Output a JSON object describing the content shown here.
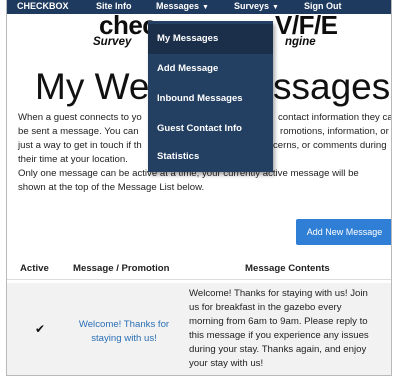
{
  "nav": {
    "brand": "CHECKBOX",
    "site_info": "Site Info",
    "messages": "Messages",
    "surveys": "Surveys",
    "sign_out": "Sign Out",
    "caret": "▼"
  },
  "dropdown": {
    "items": [
      "My Messages",
      "Add Message",
      "Inbound Messages",
      "Guest Contact Info",
      "Statistics"
    ]
  },
  "logo": {
    "left_main": "chec",
    "right_main": "V/F/E",
    "left_sub": "Survey",
    "right_sub": "ngine"
  },
  "page": {
    "title_left": "My Wel",
    "title_right": "ssages",
    "intro_lines": [
      {
        "left": "When a guest connects to yo",
        "right": "contact information they can"
      },
      {
        "left": "be sent a message. You can",
        "right": "romotions, information, or"
      },
      {
        "left": "just a way to get in touch if th",
        "right": "cerns, or comments during"
      },
      {
        "left": "their time at your location.",
        "right": ""
      }
    ],
    "note_lines": [
      "Only one message can be active at a time; your currently active message will be",
      "shown at the top of the Message List below."
    ],
    "add_button": "Add New Message"
  },
  "table": {
    "headers": [
      "Active",
      "Message / Promotion",
      "Message Contents"
    ],
    "rows": [
      {
        "active": "✔",
        "promotion_lines": [
          "Welcome! Thanks for",
          "staying with us!"
        ],
        "contents_lines": [
          "Welcome! Thanks for staying with us! Join",
          "us for breakfast in the gazebo every",
          "morning from 6am to 9am. Please reply to",
          "this message if you experience any issues",
          "during your stay. Thanks again, and enjoy",
          "your stay with us!"
        ]
      }
    ]
  }
}
